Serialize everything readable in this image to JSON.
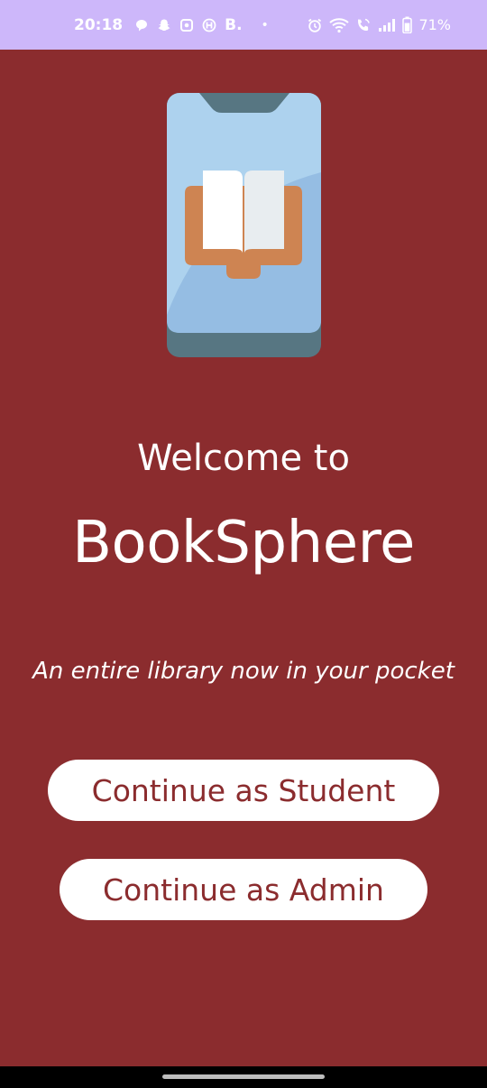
{
  "status_bar": {
    "time": "20:18",
    "notification_icons": [
      "chat-bubble-icon",
      "snapchat-icon",
      "app-icon",
      "h-logo-icon"
    ],
    "b_label": "B.",
    "dot": "•",
    "system_icons": [
      "alarm-icon",
      "wifi-icon",
      "wifi-call-icon",
      "signal-icon",
      "battery-icon"
    ],
    "battery_percent": "71%",
    "background_color": "#CDB7FA"
  },
  "welcome": {
    "heading": "Welcome to",
    "app_name": "BookSphere",
    "tagline": "An entire library now in your pocket"
  },
  "buttons": {
    "student_label": "Continue as Student",
    "admin_label": "Continue as Admin"
  },
  "illustration": {
    "icon": "phone-book-icon"
  },
  "colors": {
    "background": "#8B2C2E",
    "button_bg": "#FFFFFF",
    "button_text": "#8B2C2E"
  }
}
